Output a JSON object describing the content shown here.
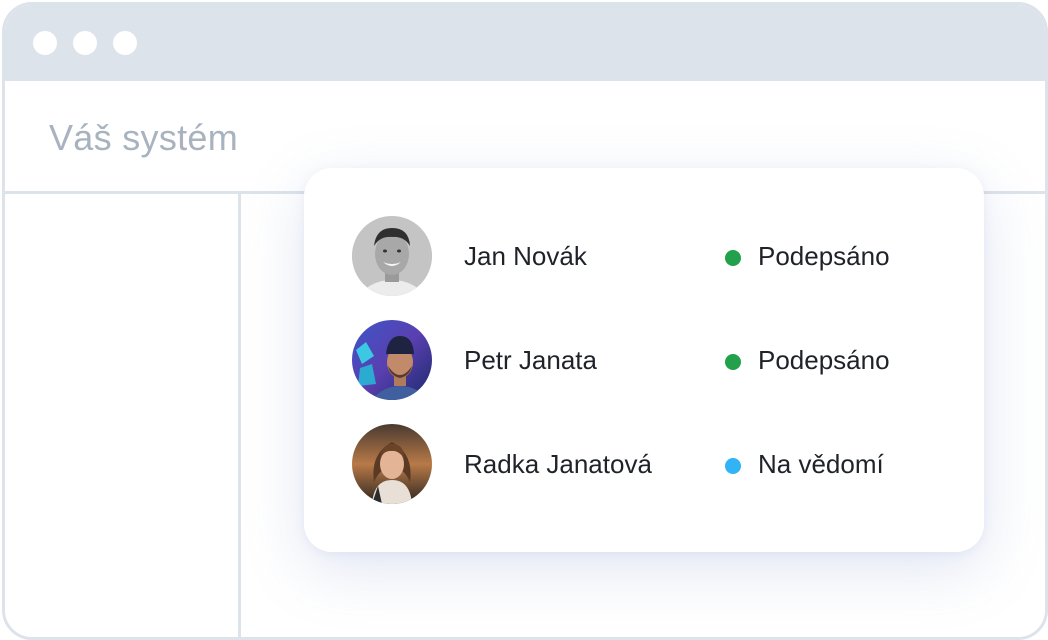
{
  "window": {
    "title": "Váš systém"
  },
  "signers": [
    {
      "name": "Jan Novák",
      "status": "Podepsáno",
      "status_color": "#22a04b",
      "avatar": "avatar-jan-novak"
    },
    {
      "name": "Petr Janata",
      "status": "Podepsáno",
      "status_color": "#22a04b",
      "avatar": "avatar-petr-janata"
    },
    {
      "name": "Radka Janatová",
      "status": "Na vědomí",
      "status_color": "#31b3f5",
      "avatar": "avatar-radka-janatova"
    }
  ],
  "colors": {
    "frame": "#dde3ea",
    "title_text": "#a8b3bf",
    "text": "#1f2329",
    "signed": "#22a04b",
    "acknowledged": "#31b3f5"
  }
}
